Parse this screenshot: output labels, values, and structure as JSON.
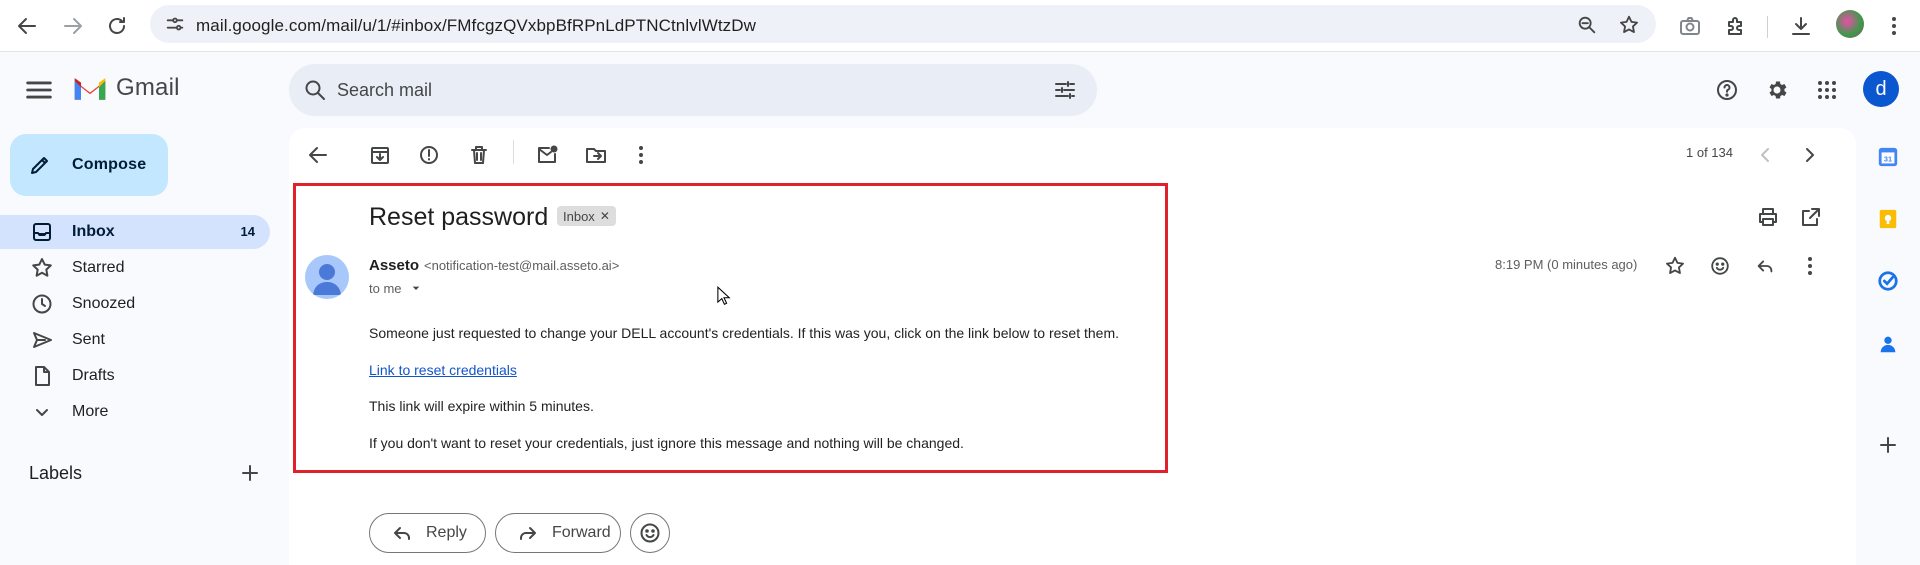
{
  "browser": {
    "url": "mail.google.com/mail/u/1/#inbox/FMfcgzQVxbpBfRPnLdPTNCtnlvlWtzDw",
    "icons": [
      "back-arrow",
      "forward-arrow",
      "reload",
      "site-settings",
      "zoom",
      "bookmark-star",
      "camera",
      "extensions",
      "downloads",
      "profile"
    ]
  },
  "header": {
    "app_name": "Gmail",
    "search_placeholder": "Search mail",
    "avatar_letter": "d"
  },
  "sidebar": {
    "compose_label": "Compose",
    "items": [
      {
        "label": "Inbox",
        "count": "14",
        "icon": "inbox-icon",
        "active": true
      },
      {
        "label": "Starred",
        "count": "",
        "icon": "star-icon"
      },
      {
        "label": "Snoozed",
        "count": "",
        "icon": "clock-icon"
      },
      {
        "label": "Sent",
        "count": "",
        "icon": "send-icon"
      },
      {
        "label": "Drafts",
        "count": "",
        "icon": "draft-icon"
      },
      {
        "label": "More",
        "count": "",
        "icon": "chevron-down-icon"
      }
    ],
    "labels_heading": "Labels"
  },
  "toolbar": {
    "pagination": "1 of 134"
  },
  "email": {
    "subject": "Reset password",
    "label_chip": "Inbox",
    "sender_name": "Asseto",
    "sender_email": "<notification-test@mail.asseto.ai>",
    "recipient": "to me",
    "time": "8:19 PM (0 minutes ago)",
    "body": {
      "line1": "Someone just requested to change your DELL account's credentials. If this was you, click on the link below to reset them.",
      "link": "Link to reset credentials",
      "line2": "This link will expire within 5 minutes.",
      "line3": "If you don't want to reset your credentials, just ignore this message and nothing will be changed."
    },
    "highlight_color": "#e0202a"
  },
  "actions": {
    "reply": "Reply",
    "forward": "Forward"
  },
  "colors": {
    "compose_bg": "#c2e7ff",
    "active_nav_bg": "#d3e3fd",
    "avatar_bg": "#0b57d0",
    "link": "#1155cc"
  }
}
